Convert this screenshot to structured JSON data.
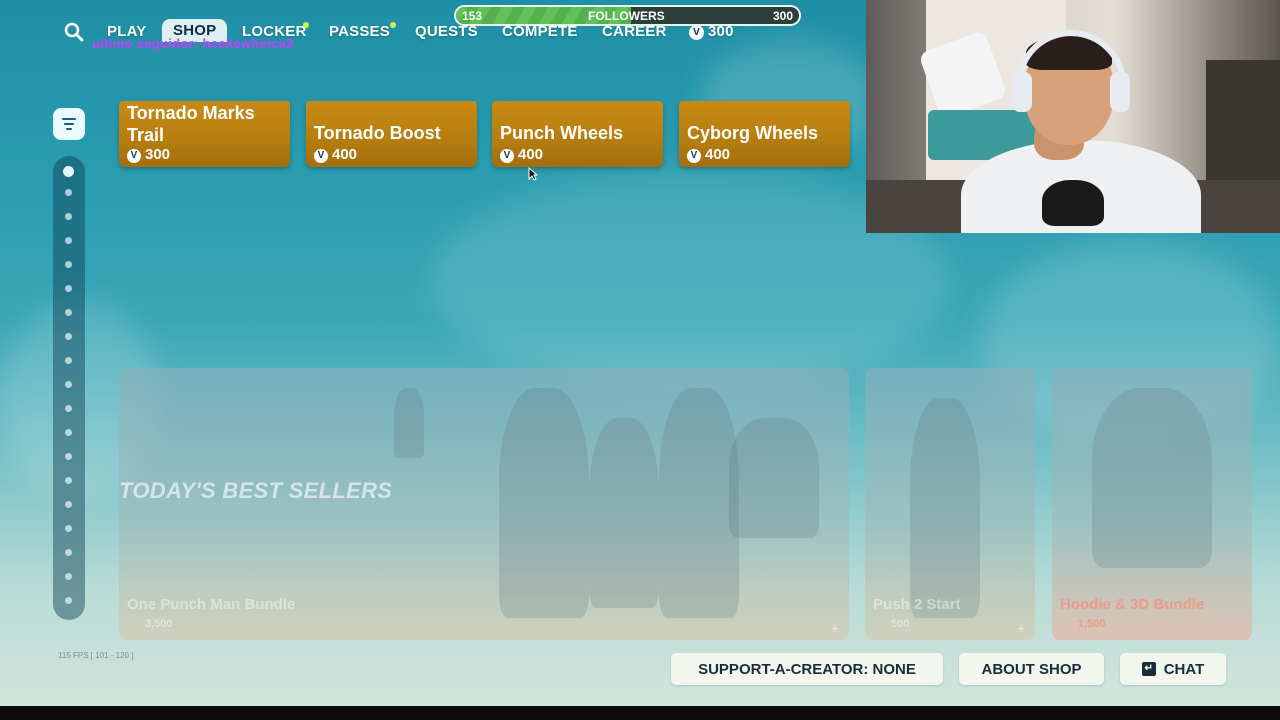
{
  "nav": {
    "items": [
      "PLAY",
      "SHOP",
      "LOCKER",
      "PASSES",
      "QUESTS",
      "COMPETE",
      "CAREER"
    ],
    "active": "SHOP",
    "vbucks": "300"
  },
  "overlay_text": "ultimo seguidor: hcekewheica2",
  "followers": {
    "label": "FOLLOWERS",
    "current": "153",
    "goal": "300",
    "progress": 0.51
  },
  "cards": [
    {
      "name": "Tornado Marks Trail",
      "price": "300"
    },
    {
      "name": "Tornado Boost",
      "price": "400"
    },
    {
      "name": "Punch Wheels",
      "price": "400"
    },
    {
      "name": "Cyborg Wheels",
      "price": "400"
    }
  ],
  "vbucks_symbol": "V",
  "section": {
    "title": "TODAY'S BEST SELLERS",
    "items": [
      {
        "name": "One Punch Man Bundle",
        "price": "3,500"
      },
      {
        "name": "Push 2 Start",
        "price": "500"
      },
      {
        "name": "Hoodie & 3D Bundle",
        "price": "1,500"
      }
    ]
  },
  "fps_text": "115 FPS [ 101 - 120 ]",
  "bottom": {
    "support": "SUPPORT-A-CREATOR: NONE",
    "about": "ABOUT SHOP",
    "chat": "CHAT",
    "chat_key": "↵"
  },
  "colors": {
    "card": "#b57d10",
    "accent_dot": "#d8f542",
    "overlay_text": "#c83dfc",
    "followers_fill": "#62c15b"
  }
}
